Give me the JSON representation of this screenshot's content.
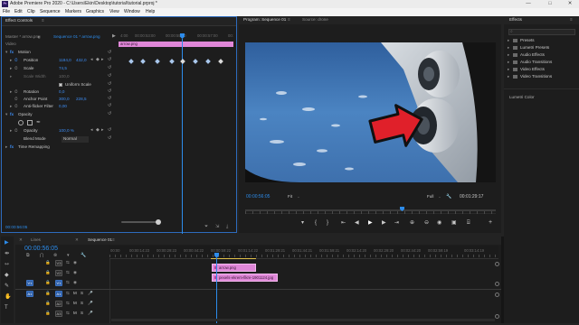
{
  "window": {
    "app_icon_label": "Pr",
    "title": "Adobe Premiere Pro 2020 - C:\\Users\\Ekin\\Desktop\\tutorial\\tutorial.prproj *",
    "controls": [
      "—",
      "□",
      "✕"
    ]
  },
  "menu": [
    "File",
    "Edit",
    "Clip",
    "Sequence",
    "Markers",
    "Graphics",
    "View",
    "Window",
    "Help"
  ],
  "effect_controls": {
    "tab": "Effect Controls",
    "tab_menu": "≡",
    "master": "Master * arrow.png",
    "sequence": "Sequence 01 * arrow.png",
    "play_icon": "▶",
    "ruler_times": [
      "4:00",
      "00:00:53:00",
      "00:00:55:00",
      "00:00:57:00",
      "00:"
    ],
    "clip_label": "arrow.png",
    "video_label": "Video",
    "motion_label": "Motion",
    "properties": [
      {
        "name": "Position",
        "v1": "1184,0",
        "v2": "432,0"
      },
      {
        "name": "Scale",
        "v1": "74,5",
        "v2": ""
      },
      {
        "name": "Scale Width",
        "v1": "100,0",
        "v2": ""
      }
    ],
    "uniform_scale": "Uniform Scale",
    "properties2": [
      {
        "name": "Rotation",
        "v1": "0,0",
        "v2": ""
      },
      {
        "name": "Anchor Point",
        "v1": "300,0",
        "v2": "228,5"
      },
      {
        "name": "Anti-flicker Filter",
        "v1": "0,00",
        "v2": ""
      }
    ],
    "opacity_label": "Opacity",
    "opacity_value": "100,0 %",
    "blend_label": "Blend Mode",
    "blend_value": "Normal",
    "time_remap": "Time Remapping",
    "footer_time": "00:00:56:05"
  },
  "program": {
    "tab": "Program: Sequence 01",
    "tab_menu": "≡",
    "source_tab": "Source: drone",
    "timecode": "00:00:56:05",
    "fit": "Fit",
    "full": "Full",
    "duration": "00:01:29:17",
    "transport": [
      "▾",
      "{",
      "}",
      "⇤",
      "◀",
      "▶",
      "▶",
      "⇥",
      "⊕",
      "⊖",
      "◉",
      "▣",
      "⌸",
      "+"
    ]
  },
  "effects": {
    "tab": "Effects",
    "tab_menu": "≡",
    "search_placeholder": "",
    "items": [
      "Presets",
      "Lumetri Presets",
      "Audio Effects",
      "Audio Transitions",
      "Video Effects",
      "Video Transitions"
    ],
    "lumetri_color": "Lumetri Color"
  },
  "timeline": {
    "tabs": [
      "Lines",
      "Sequence 01"
    ],
    "timecode": "00:00:56:05",
    "ruler": [
      "00:00",
      "00:00:14:23",
      "00:00:29:23",
      "00:00:44:22",
      "00:00:59:22",
      "00:01:14:22",
      "00:01:29:21",
      "00:01:44:21",
      "00:01:59:21",
      "00:02:14:20",
      "00:02:29:20",
      "00:02:44:20",
      "00:02:59:19",
      "00:03:14:19"
    ],
    "tracks": [
      {
        "name": "V3",
        "src": ""
      },
      {
        "name": "V2",
        "src": ""
      },
      {
        "name": "V1",
        "src": "V1"
      },
      {
        "name": "A1",
        "src": "A1"
      },
      {
        "name": "A2",
        "src": ""
      },
      {
        "name": "A3",
        "src": ""
      }
    ],
    "track_flags": [
      "M",
      "S"
    ],
    "clip_v2": "arrow.png",
    "clip_v1": "pexels-ekrem-fikre-1901124.jpg"
  },
  "tools": [
    "▶",
    "⇹",
    "⇿",
    "◆",
    "✎",
    "✋",
    "T"
  ],
  "colors": {
    "accent_blue": "#2d8ceb",
    "clip_pink": "#e087d8",
    "sky": "#4b84c2"
  }
}
